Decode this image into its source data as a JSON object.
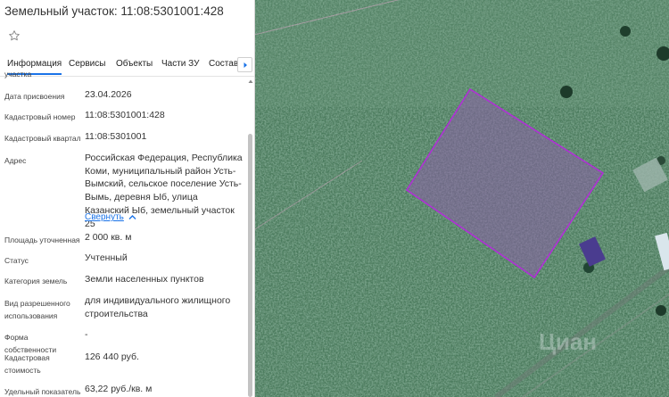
{
  "header": {
    "title": "Земельный участок: 11:08:5301001:428"
  },
  "tabs": [
    {
      "label": "Информация"
    },
    {
      "label": "Сервисы"
    },
    {
      "label": "Объекты"
    },
    {
      "label": "Части ЗУ"
    },
    {
      "label": "Состав"
    }
  ],
  "clipped_label": "участка",
  "fields": {
    "assign_date": {
      "label": "Дата присвоения",
      "value": "23.04.2026"
    },
    "cadastral_number": {
      "label": "Кадастровый номер",
      "value": "11:08:5301001:428"
    },
    "cadastral_quarter": {
      "label": "Кадастровый квартал",
      "value": "11:08:5301001"
    },
    "address": {
      "label": "Адрес",
      "value": "Российская Федерация, Республика Коми, муниципальный район Усть-Вымский, сельское поселение Усть-Вымь, деревня Ыб, улица Казанский Ыб, земельный участок 25",
      "collapse": "Свернуть"
    },
    "area": {
      "label": "Площадь уточненная",
      "value": "2 000 кв. м"
    },
    "status": {
      "label": "Статус",
      "value": "Учтенный"
    },
    "land_category": {
      "label": "Категория земель",
      "value": "Земли населенных пунктов"
    },
    "permitted_use": {
      "label": "Вид разрешенного использования",
      "value": "для индивидуального жилищного строительства"
    },
    "ownership": {
      "label": "Форма собственности",
      "value": "-"
    },
    "cadastral_cost": {
      "label": "Кадастровая стоимость",
      "value": "126 440 руб."
    },
    "unit_cost": {
      "label": "Удельный показатель",
      "value": "63,22 руб./кв. м"
    }
  },
  "map": {
    "watermark": "Циан"
  },
  "colors": {
    "accent": "#1a73e8",
    "parcel": "#b02fd6"
  }
}
